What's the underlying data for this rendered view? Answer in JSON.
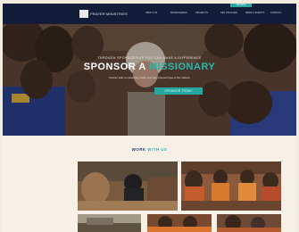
{
  "nav": {
    "logo_text": "PRAYER MINISTRIES",
    "menu": [
      "ABOUT US",
      "MISSIONARIES",
      "PROJECTS",
      "GET INVOLVED",
      "NEWS & EVENTS",
      "CONTACT"
    ],
    "donate_label": "DONATE"
  },
  "hero": {
    "kicker": "THROUGH SPONSORSHIP YOU CAN MAKE A DIFFERENCE",
    "title_part1": "SPONSOR A ",
    "title_part2": "MISSIONARY",
    "subtitle": "Partner with a missionary today and help spread hope to the nations",
    "cta_label": "SPONSOR TODAY"
  },
  "work_section": {
    "title_part1": "WORK ",
    "title_part2": "WITH US"
  },
  "colors": {
    "nav_bg": "#131c38",
    "accent": "#26b8ad",
    "heading_blue": "#1d3b78"
  },
  "icons": {
    "logo": "ministry-logo-icon"
  }
}
